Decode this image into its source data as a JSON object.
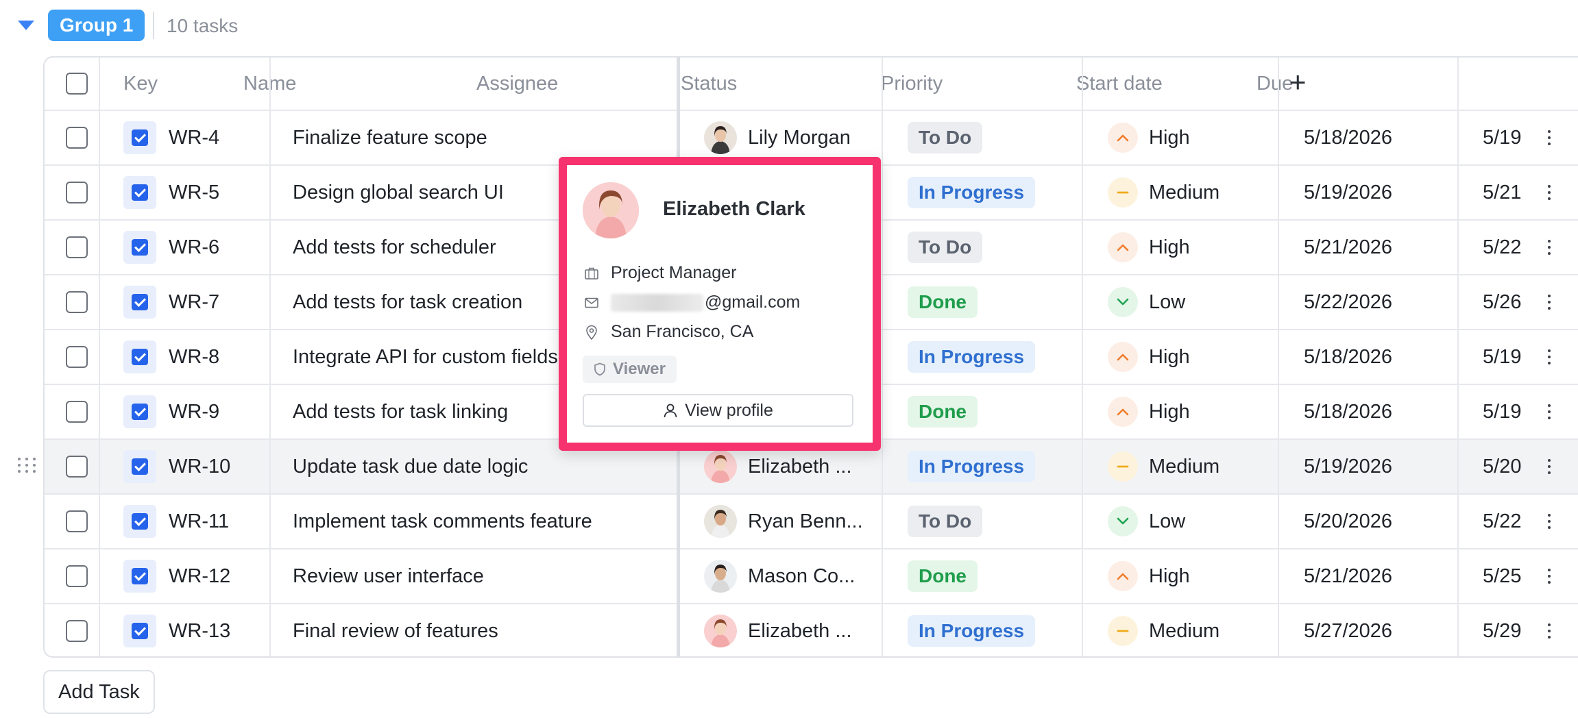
{
  "group": {
    "label": "Group 1",
    "count": "10 tasks"
  },
  "columns": {
    "key": "Key",
    "name": "Name",
    "assignee": "Assignee",
    "status": "Status",
    "priority": "Priority",
    "start": "Start date",
    "due": "Due"
  },
  "rows": [
    {
      "key": "WR-4",
      "name": "Finalize feature scope",
      "assignee": "Lily Morgan",
      "status": "To Do",
      "priority": "High",
      "start": "5/18/2026",
      "due": "5/19"
    },
    {
      "key": "WR-5",
      "name": "Design global search UI",
      "assignee": "",
      "status": "In Progress",
      "priority": "Medium",
      "start": "5/19/2026",
      "due": "5/21"
    },
    {
      "key": "WR-6",
      "name": "Add tests for scheduler",
      "assignee": "",
      "status": "To Do",
      "priority": "High",
      "start": "5/21/2026",
      "due": "5/22"
    },
    {
      "key": "WR-7",
      "name": "Add tests for task creation",
      "assignee": "",
      "status": "Done",
      "priority": "Low",
      "start": "5/22/2026",
      "due": "5/26"
    },
    {
      "key": "WR-8",
      "name": "Integrate API for custom fields",
      "assignee": "",
      "status": "In Progress",
      "priority": "High",
      "start": "5/18/2026",
      "due": "5/19"
    },
    {
      "key": "WR-9",
      "name": "Add tests for task linking",
      "assignee": "",
      "status": "Done",
      "priority": "High",
      "start": "5/18/2026",
      "due": "5/19"
    },
    {
      "key": "WR-10",
      "name": "Update task due date logic",
      "assignee": "Elizabeth ...",
      "status": "In Progress",
      "priority": "Medium",
      "start": "5/19/2026",
      "due": "5/20"
    },
    {
      "key": "WR-11",
      "name": "Implement task comments feature",
      "assignee": "Ryan Benn...",
      "status": "To Do",
      "priority": "Low",
      "start": "5/20/2026",
      "due": "5/22"
    },
    {
      "key": "WR-12",
      "name": "Review user interface",
      "assignee": "Mason Co...",
      "status": "Done",
      "priority": "High",
      "start": "5/21/2026",
      "due": "5/25"
    },
    {
      "key": "WR-13",
      "name": "Final review of features",
      "assignee": "Elizabeth ...",
      "status": "In Progress",
      "priority": "Medium",
      "start": "5/27/2026",
      "due": "5/29"
    }
  ],
  "popover": {
    "name": "Elizabeth Clark",
    "title": "Project Manager",
    "email_suffix": "@gmail.com",
    "location": "San Francisco, CA",
    "role": "Viewer",
    "view_profile": "View profile"
  },
  "add_task": "Add Task",
  "colors": {
    "accent": "#3ea0f5",
    "highlight_border": "#f6336e"
  }
}
